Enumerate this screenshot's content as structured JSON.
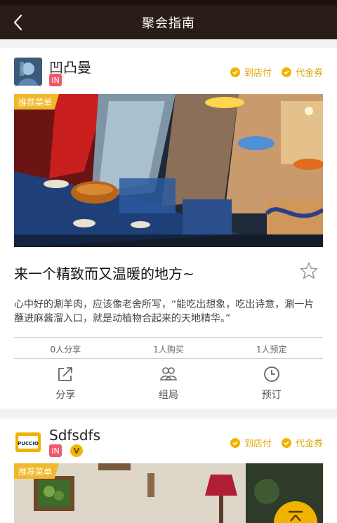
{
  "header": {
    "title": "聚会指南"
  },
  "posts": [
    {
      "shop_name": "凹凸曼",
      "badges": [
        "IN"
      ],
      "tags": [
        "到店付",
        "代金券"
      ],
      "photo_label": "推荐菜单",
      "title": "来一个精致而又温暖的地方~",
      "description": "心中好的涮羊肉，应该像老舍所写，“能吃出想象，吃出诗意，涮一片蘸进麻酱溜入口，就是动植物合起来的天地精华。”",
      "stats": [
        "0人分享",
        "1人购买",
        "1人预定"
      ],
      "actions": [
        "分享",
        "组局",
        "预订"
      ]
    },
    {
      "shop_name": "Sdfsdfs",
      "badges": [
        "IN",
        "V"
      ],
      "tags": [
        "到店付",
        "代金券"
      ],
      "photo_label": "推荐菜单",
      "avatar_text": "PUCCIO"
    }
  ],
  "icons": {
    "back": "chevron-left-icon",
    "favorite": "star-outline-icon",
    "share": "share-icon",
    "group": "group-icon",
    "reserve": "clock-icon",
    "scroll_top": "arrow-up-icon"
  },
  "colors": {
    "accent": "#f0b400",
    "navbar": "#2a1d18",
    "in_badge": "#ef5a6a"
  }
}
